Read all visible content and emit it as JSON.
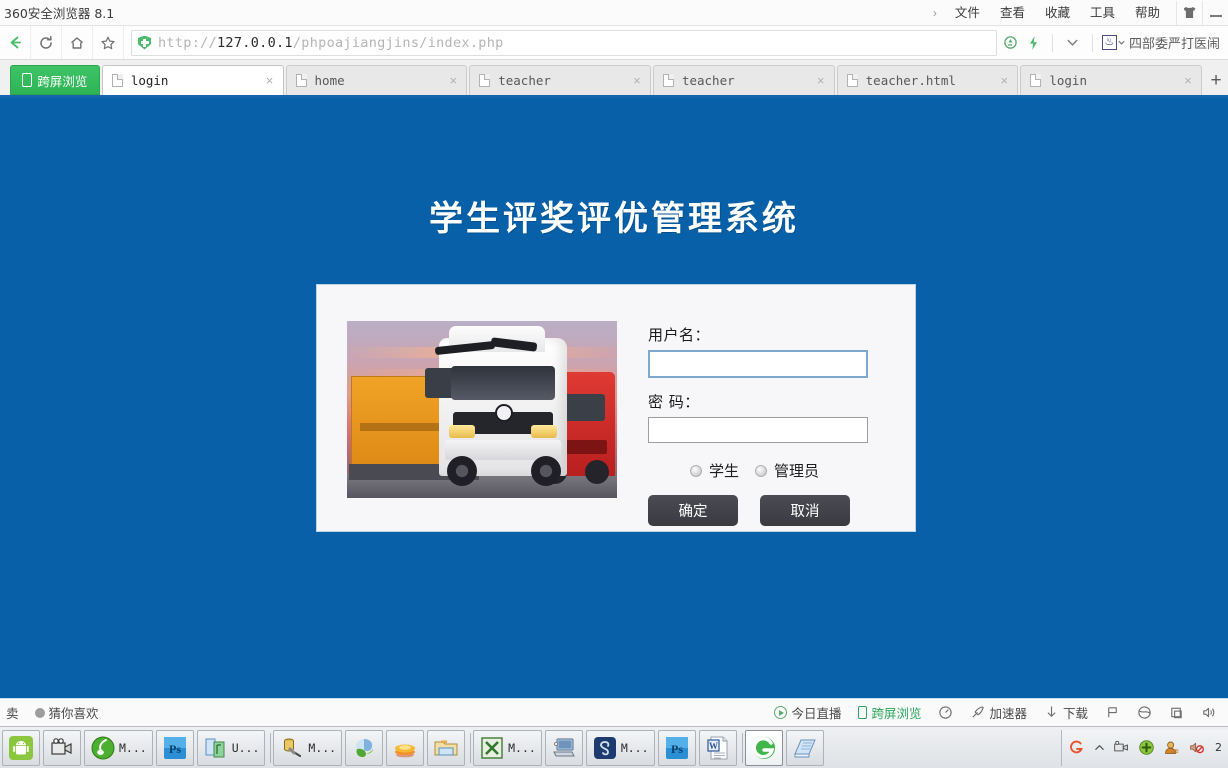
{
  "window": {
    "browser_name": "360安全浏览器 8.1",
    "menu": [
      "文件",
      "查看",
      "收藏",
      "工具",
      "帮助"
    ],
    "chevron": "›",
    "skin_icon": "shirt-icon",
    "minimize_icon": "minimize-icon"
  },
  "address_bar": {
    "back_icon": "back-arrow-icon",
    "reload_icon": "reload-icon",
    "home_icon": "home-icon",
    "bookmark_icon": "star-icon",
    "security_icon": "shield-icon",
    "url_scheme": "http://",
    "url_host": "127.0.0.1",
    "url_path": "/phpoajiangjins/index.php",
    "url_full": "http://127.0.0.1/phpoajiangjins/index.php",
    "icons": [
      "recycle-icon",
      "lightning-icon",
      "chevron-down-icon"
    ],
    "search_site_icon": "baidu-paw-icon",
    "search_text": "四部委严打医闹"
  },
  "tabs": {
    "cast_tab": {
      "label": "跨屏浏览",
      "icon": "phone-icon"
    },
    "items": [
      {
        "label": "login",
        "active": true,
        "close": "×"
      },
      {
        "label": "home",
        "active": false,
        "close": "×"
      },
      {
        "label": "teacher",
        "active": false,
        "close": "×"
      },
      {
        "label": "teacher",
        "active": false,
        "close": "×"
      },
      {
        "label": "teacher.html",
        "active": false,
        "close": "×"
      },
      {
        "label": "login",
        "active": false,
        "close": "×"
      }
    ],
    "new_tab": "+"
  },
  "page": {
    "title": "学生评奖评优管理系统",
    "background_color": "#0760a8",
    "card_color": "#f7f7fa",
    "photo": {
      "name": "truck-photo",
      "alt": "两辆卡车，橙色货柜与红色卡车，背景为晚霞天空"
    },
    "form": {
      "username_label": "用户名：",
      "username_value": "",
      "username_placeholder": "",
      "password_label": "密 码：",
      "password_value": "",
      "password_placeholder": "",
      "roles": [
        {
          "label": "学生",
          "selected": false
        },
        {
          "label": "管理员",
          "selected": false
        }
      ],
      "submit_label": "确定",
      "cancel_label": "取消"
    }
  },
  "status_bar": {
    "left": [
      {
        "label": "卖",
        "icon": ""
      },
      {
        "label": "猜你喜欢",
        "icon": "gray-dot-icon"
      }
    ],
    "right": [
      {
        "label": "今日直播",
        "icon": "play-circle-icon",
        "green": false
      },
      {
        "label": "跨屏浏览",
        "icon": "phone-icon",
        "green": true
      },
      {
        "label": "",
        "icon": "speed-dial-icon",
        "green": false
      },
      {
        "label": "加速器",
        "icon": "rocket-icon",
        "green": false
      },
      {
        "label": "下载",
        "icon": "download-arrow-icon",
        "green": false
      },
      {
        "label": "",
        "icon": "flag-icon",
        "green": false
      },
      {
        "label": "",
        "icon": "globe-icon",
        "green": false
      },
      {
        "label": "",
        "icon": "window-icon",
        "green": false
      },
      {
        "label": "",
        "icon": "volume-icon",
        "green": false
      }
    ]
  },
  "taskbar": {
    "items": [
      {
        "label": "",
        "icon": "android-icon",
        "active": false
      },
      {
        "label": "",
        "icon": "video-camera-icon",
        "active": false
      },
      {
        "label": "M...",
        "icon": "green-music-icon",
        "active": false
      },
      {
        "label": "",
        "icon": "photoshop-icon",
        "active": false
      },
      {
        "label": "U...",
        "icon": "ultraedit-icon",
        "active": false
      },
      {
        "label": "M...",
        "icon": "database-tool-icon",
        "active": false
      },
      {
        "label": "",
        "icon": "navicat-icon",
        "active": false
      },
      {
        "label": "",
        "icon": "orange-disc-icon",
        "active": false
      },
      {
        "label": "",
        "icon": "folder-icon",
        "active": false
      },
      {
        "label": "M...",
        "icon": "excel-icon",
        "active": false
      },
      {
        "label": "",
        "icon": "remote-desktop-icon",
        "active": false
      },
      {
        "label": "M...",
        "icon": "infinity-icon",
        "active": false
      },
      {
        "label": "",
        "icon": "photoshop-icon",
        "active": false
      },
      {
        "label": "",
        "icon": "word-icon",
        "active": false
      },
      {
        "label": "",
        "icon": "browser-360-icon",
        "active": true
      },
      {
        "label": "",
        "icon": "notepad-icon",
        "active": false
      }
    ],
    "tray": [
      {
        "icon": "sogou-icon"
      },
      {
        "icon": "chevron-up-icon"
      },
      {
        "icon": "camera-tray-icon"
      },
      {
        "icon": "green-plus-icon"
      },
      {
        "icon": "person-icon"
      },
      {
        "icon": "mute-speaker-icon"
      }
    ],
    "tray_time": "2"
  }
}
